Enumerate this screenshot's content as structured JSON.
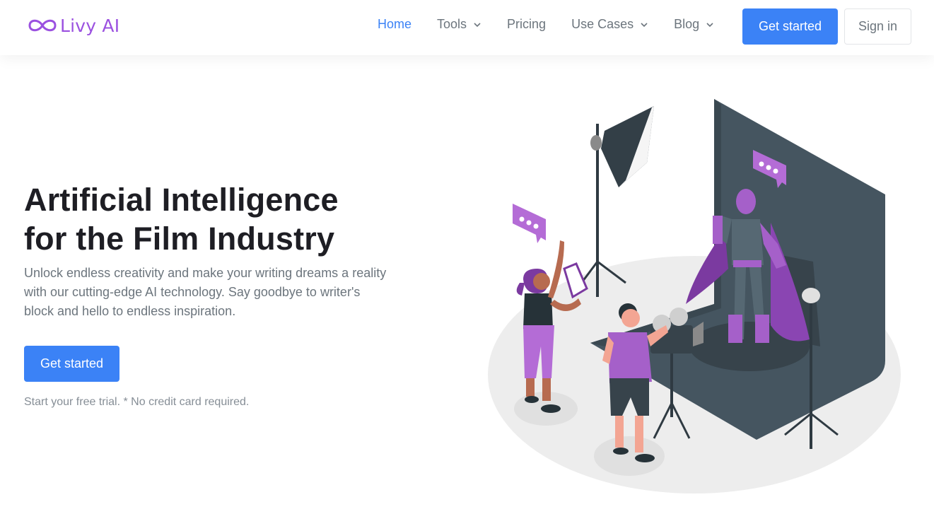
{
  "brand": {
    "name": "Livy AI",
    "logo_icon": "infinity-icon",
    "color": "#9b51e0"
  },
  "nav": {
    "items": [
      {
        "label": "Home",
        "active": true,
        "dropdown": false
      },
      {
        "label": "Tools",
        "active": false,
        "dropdown": true
      },
      {
        "label": "Pricing",
        "active": false,
        "dropdown": false
      },
      {
        "label": "Use Cases",
        "active": false,
        "dropdown": true
      },
      {
        "label": "Blog",
        "active": false,
        "dropdown": true
      }
    ],
    "get_started_label": "Get started",
    "sign_in_label": "Sign in"
  },
  "hero": {
    "title_line1": "Artificial Intelligence",
    "title_line2": "for the Film Industry",
    "subtitle": "Unlock endless creativity and make your writing dreams a reality with our cutting-edge AI technology. Say goodbye to writer's block and hello to endless inspiration.",
    "cta_label": "Get started",
    "note": "Start your free trial. * No credit card required."
  },
  "colors": {
    "accent": "#3b82f6",
    "brand_purple": "#9b51e0",
    "muted_text": "#6c757d"
  }
}
